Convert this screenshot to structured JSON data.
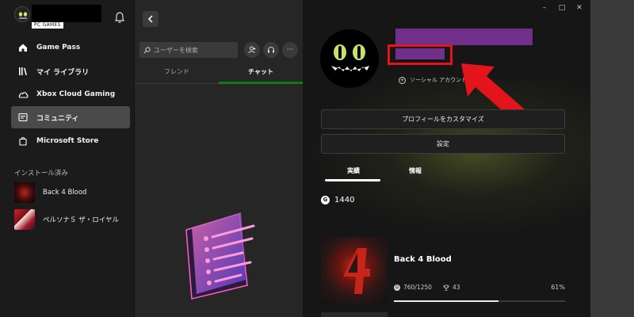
{
  "sidebar": {
    "pc_games_badge": "PC GAMES",
    "nav": [
      {
        "label": "Game Pass",
        "icon": "home-icon"
      },
      {
        "label": "マイ ライブラリ",
        "icon": "library-icon"
      },
      {
        "label": "Xbox Cloud Gaming",
        "icon": "cloud-icon"
      },
      {
        "label": "コミュニティ",
        "icon": "community-icon",
        "active": true
      },
      {
        "label": "Microsoft Store",
        "icon": "store-icon"
      }
    ],
    "installed_label": "インストール済み",
    "installed": [
      {
        "label": "Back 4 Blood"
      },
      {
        "label": "ペルソナ５ ザ・ロイヤル"
      }
    ]
  },
  "midpanel": {
    "search_placeholder": "ユーザーを検索",
    "more_label": "···",
    "tabs": [
      {
        "label": "フレンド",
        "active": false
      },
      {
        "label": "チャット",
        "active": true
      }
    ]
  },
  "profile": {
    "social_link": "ソーシャル アカウントを",
    "customize_button": "プロフィールをカスタマイズ",
    "settings_button": "設定",
    "tabs": [
      {
        "label": "実績",
        "active": true
      },
      {
        "label": "情報",
        "active": false
      }
    ],
    "gamerscore_badge": "G",
    "gamerscore": "1440",
    "game": {
      "title": "Back 4 Blood",
      "score": "760/1250",
      "achievements": "43",
      "percent": "61%",
      "progress": 0.61
    }
  },
  "window": {
    "minimize": "–",
    "maximize": "□",
    "close": "✕"
  },
  "colors": {
    "redaction": "#6f2f8a",
    "highlight_red": "#e4141c",
    "xbox_green": "#107c10"
  }
}
